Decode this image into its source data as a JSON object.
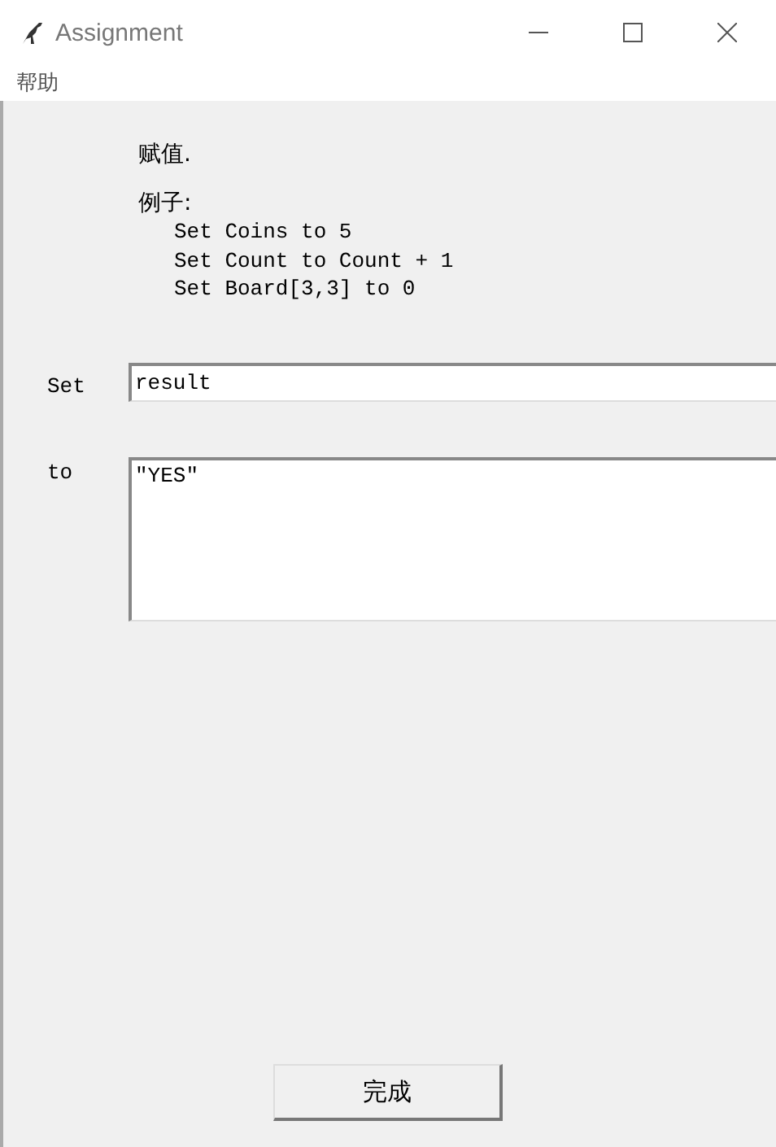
{
  "window": {
    "title": "Assignment"
  },
  "menu": [
    "帮助"
  ],
  "heading": "赋值.",
  "examples_label": "例子:",
  "examples": [
    "Set Coins to 5",
    "Set Count to Count + 1",
    "Set Board[3,3] to 0"
  ],
  "set_field": {
    "label": "Set",
    "value": "result"
  },
  "to_field": {
    "label": "to",
    "value": "\"YES\""
  },
  "buttons": [
    "完成"
  ]
}
